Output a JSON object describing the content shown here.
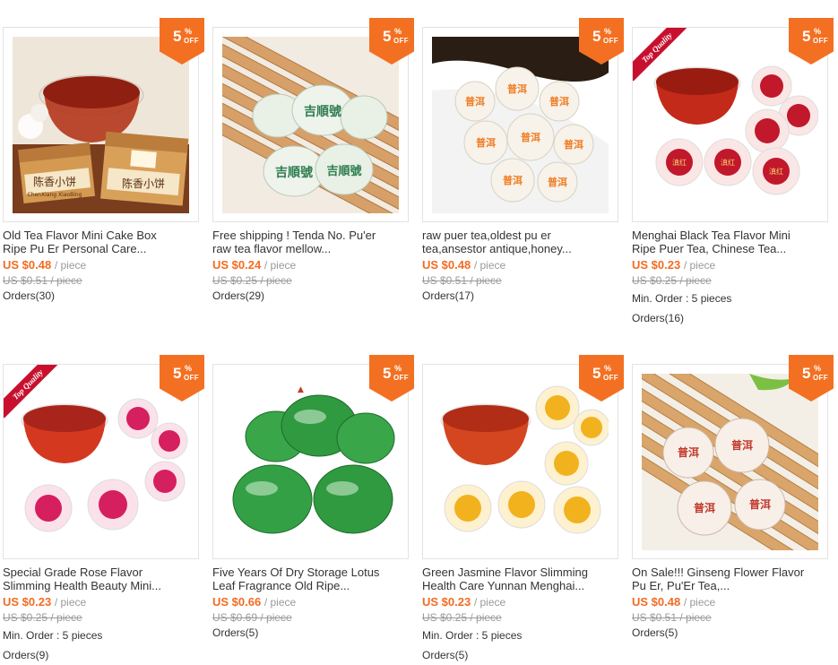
{
  "badge": {
    "number": "5",
    "percent": "%",
    "off": "OFF"
  },
  "ribbon_label": "Top Quality",
  "packaging_text": {
    "box_label": "陈香小饼",
    "box_sublabel": "ChenXiang XiaoBing",
    "seal_green": "吉順號",
    "seal_script": "普洱",
    "seal_red": "滇红"
  },
  "products": [
    {
      "title_line1": "Old Tea Flavor Mini Cake Box",
      "title_line2": "Ripe Pu Er Personal Care...",
      "price": "US $0.48",
      "unit": "/ piece",
      "old_price": "US $0.51 / piece",
      "min_order": "",
      "orders": "Orders(30)"
    },
    {
      "title_line1": "Free shipping ! Tenda No. Pu'er",
      "title_line2": "raw tea flavor mellow...",
      "price": "US $0.24",
      "unit": "/ piece",
      "old_price": "US $0.25 / piece",
      "min_order": "",
      "orders": "Orders(29)"
    },
    {
      "title_line1": "raw puer tea,oldest pu er",
      "title_line2": "tea,ansestor antique,honey...",
      "price": "US $0.48",
      "unit": "/ piece",
      "old_price": "US $0.51 / piece",
      "min_order": "",
      "orders": "Orders(17)"
    },
    {
      "title_line1": "Menghai Black Tea Flavor Mini",
      "title_line2": "Ripe Puer Tea, Chinese Tea...",
      "price": "US $0.23",
      "unit": "/ piece",
      "old_price": "US $0.25 / piece",
      "min_order": "Min. Order : 5 pieces",
      "orders": "Orders(16)"
    },
    {
      "title_line1": "Special Grade Rose Flavor",
      "title_line2": "Slimming Health Beauty Mini...",
      "price": "US $0.23",
      "unit": "/ piece",
      "old_price": "US $0.25 / piece",
      "min_order": "Min. Order : 5 pieces",
      "orders": "Orders(9)"
    },
    {
      "title_line1": "Five Years Of Dry Storage Lotus",
      "title_line2": "Leaf Fragrance Old Ripe...",
      "price": "US $0.66",
      "unit": "/ piece",
      "old_price": "US $0.69 / piece",
      "min_order": "",
      "orders": "Orders(5)"
    },
    {
      "title_line1": "Green Jasmine Flavor Slimming",
      "title_line2": "Health Care Yunnan Menghai...",
      "price": "US $0.23",
      "unit": "/ piece",
      "old_price": "US $0.25 / piece",
      "min_order": "Min. Order : 5 pieces",
      "orders": "Orders(5)"
    },
    {
      "title_line1": "On Sale!!! Ginseng Flower Flavor",
      "title_line2": "Pu Er, Pu'Er Tea,...",
      "price": "US $0.48",
      "unit": "/ piece",
      "old_price": "US $0.51 / piece",
      "min_order": "",
      "orders": "Orders(5)"
    }
  ]
}
